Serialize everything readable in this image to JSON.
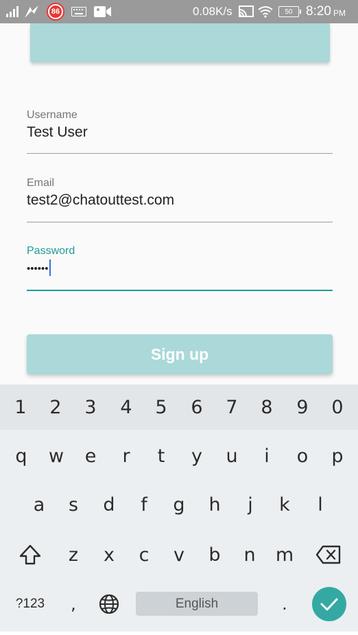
{
  "status_bar": {
    "network_speed": "0.08K/s",
    "time": "8:20",
    "ampm": "PM",
    "battery_level": "50",
    "notification_badge": "86",
    "colors": {
      "background": "#9a9a9a",
      "text": "#ffffff"
    },
    "icons": [
      "signal-icon",
      "vpn-icon",
      "notification-badge-icon",
      "keyboard-icon",
      "video-camera-icon",
      "cast-icon",
      "wifi-icon",
      "battery-icon"
    ]
  },
  "form": {
    "username": {
      "label": "Username",
      "value": "Test User"
    },
    "email": {
      "label": "Email",
      "value": "test2@chatouttest.com"
    },
    "password": {
      "label": "Password",
      "value": "••••••"
    },
    "signup_label": "Sign up",
    "colors": {
      "accent": "#1e9a96",
      "button": "#abd8d9",
      "button_text": "#ffffff"
    }
  },
  "keyboard": {
    "number_row": [
      "1",
      "2",
      "3",
      "4",
      "5",
      "6",
      "7",
      "8",
      "9",
      "0"
    ],
    "row1": [
      "q",
      "w",
      "e",
      "r",
      "t",
      "y",
      "u",
      "i",
      "o",
      "p"
    ],
    "row2": [
      "a",
      "s",
      "d",
      "f",
      "g",
      "h",
      "j",
      "k",
      "l"
    ],
    "row3": [
      "z",
      "x",
      "c",
      "v",
      "b",
      "n",
      "m"
    ],
    "symbols_label": "?123",
    "comma": ",",
    "period": ".",
    "space_label": "English",
    "icons": [
      "shift-icon",
      "backspace-icon",
      "globe-icon",
      "check-icon"
    ],
    "colors": {
      "background": "#eceff1",
      "enter": "#34a9a4"
    }
  }
}
